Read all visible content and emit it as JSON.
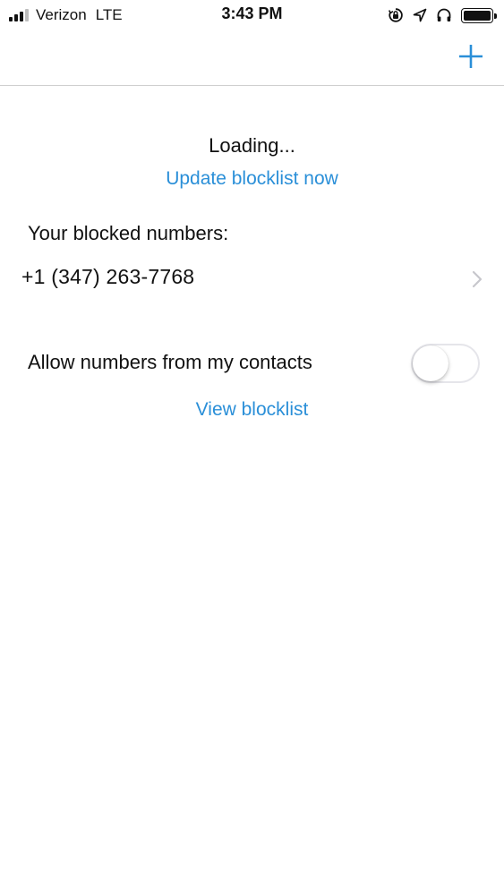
{
  "status_bar": {
    "carrier": "Verizon",
    "network": "LTE",
    "time": "3:43 PM",
    "icons": [
      "orientation-lock-icon",
      "location-arrow-icon",
      "headphones-icon",
      "battery-icon"
    ]
  },
  "nav": {
    "add_icon": "plus-icon"
  },
  "main": {
    "loading_text": "Loading...",
    "update_link": "Update blocklist now",
    "blocked_title": "Your blocked numbers:",
    "blocked_numbers": [
      "+1 (347) 263-7768"
    ],
    "allow_contacts_label": "Allow numbers from my contacts",
    "allow_contacts_enabled": false,
    "view_link": "View blocklist"
  },
  "colors": {
    "accent": "#2a8fd8",
    "divider": "#cfcfcf",
    "text": "#111111"
  }
}
